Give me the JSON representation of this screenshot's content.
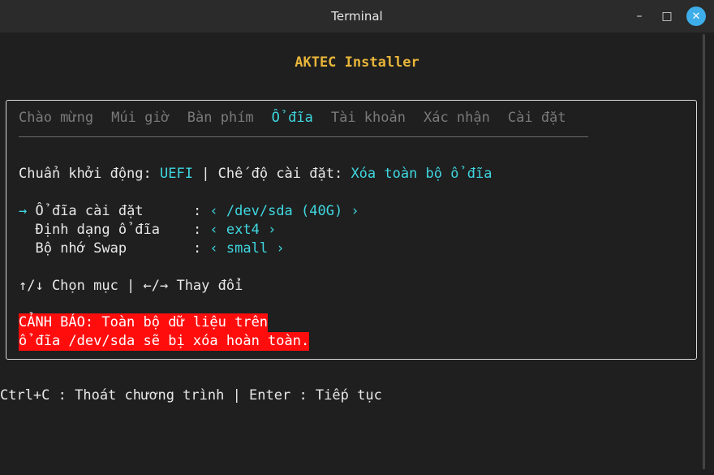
{
  "window": {
    "title": "Terminal",
    "minimize_glyph": "–",
    "maximize_glyph": "□",
    "close_glyph": "✕"
  },
  "app": {
    "title": "AKTEC Installer"
  },
  "tabs": [
    {
      "label": "Chào mừng",
      "active": false
    },
    {
      "label": "Múi giờ",
      "active": false
    },
    {
      "label": "Bàn phím",
      "active": false
    },
    {
      "label": "Ổ đĩa",
      "active": true
    },
    {
      "label": "Tài khoản",
      "active": false
    },
    {
      "label": "Xác nhận",
      "active": false
    },
    {
      "label": "Cài đặt",
      "active": false
    }
  ],
  "boot": {
    "boot_label": "Chuẩn khởi động: ",
    "boot_value": "UEFI",
    "separator": " | ",
    "mode_label": "Chế độ cài đặt: ",
    "mode_value": "Xóa toàn bộ ổ đĩa"
  },
  "options": [
    {
      "cursor": "→ ",
      "label": "Ổ đĩa cài đặt     ",
      "colon": " : ",
      "value": "‹ /dev/sda (40G) ›"
    },
    {
      "cursor": "  ",
      "label": "Định dạng ổ đĩa   ",
      "colon": " : ",
      "value": "‹ ext4 ›"
    },
    {
      "cursor": "  ",
      "label": "Bộ nhớ Swap       ",
      "colon": " : ",
      "value": "‹ small ›"
    }
  ],
  "help": "↑/↓ Chọn mục | ←/→ Thay đổi",
  "warning": {
    "line1": "CẢNH BÁO: Toàn bộ dữ liệu trên",
    "line2": "ổ đĩa /dev/sda sẽ bị xóa hoàn toàn."
  },
  "footer": "Ctrl+C : Thoát chương trình | Enter : Tiếp tục",
  "colors": {
    "accent": "#3fd7e0",
    "title": "#e8b53a",
    "warning_bg": "#ff0d0d"
  }
}
